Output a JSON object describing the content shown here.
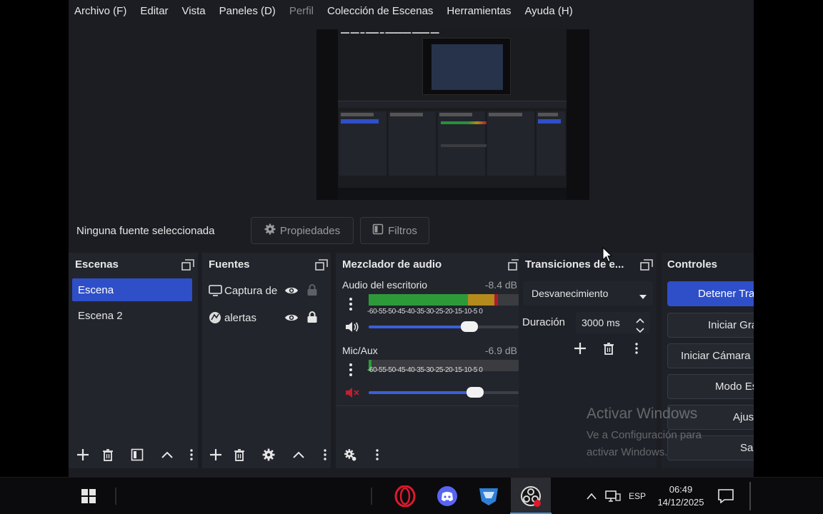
{
  "menubar": {
    "items": [
      {
        "label": "Archivo (F)",
        "dim": false
      },
      {
        "label": "Editar",
        "dim": false
      },
      {
        "label": "Vista",
        "dim": false
      },
      {
        "label": "Paneles (D)",
        "dim": false
      },
      {
        "label": "Perfil",
        "dim": true
      },
      {
        "label": "Colección de Escenas",
        "dim": false
      },
      {
        "label": "Herramientas",
        "dim": false
      },
      {
        "label": "Ayuda (H)",
        "dim": false
      }
    ]
  },
  "source_toolbar": {
    "no_source_label": "Ninguna fuente seleccionada",
    "properties_label": "Propiedades",
    "filters_label": "Filtros"
  },
  "scenes": {
    "title": "Escenas",
    "items": [
      "Escena",
      "Escena 2"
    ],
    "selected": "Escena"
  },
  "sources": {
    "title": "Fuentes",
    "items": [
      {
        "name": "Captura de",
        "icon": "monitor-icon",
        "visible": true,
        "locked": false
      },
      {
        "name": "alertas",
        "icon": "browser-icon",
        "visible": true,
        "locked": true
      }
    ]
  },
  "audio_mixer": {
    "title": "Mezclador de audio",
    "ticks": "-60-55-50-45-40-35-30-25-20-15-10-5 0",
    "channels": [
      {
        "name": "Audio del escritorio",
        "db": "-8.4 dB",
        "level": 0.86,
        "volume": 0.67,
        "muted": false
      },
      {
        "name": "Mic/Aux",
        "db": "-6.9 dB",
        "level": 0.02,
        "volume": 0.71,
        "muted": true
      }
    ]
  },
  "transitions": {
    "title": "Transiciones de e...",
    "selected": "Desvanecimiento",
    "duration_label": "Duración",
    "duration_value": "3000 ms"
  },
  "controls": {
    "title": "Controles",
    "buttons": [
      {
        "label": "Detener Transmisión",
        "primary": true
      },
      {
        "label": "Iniciar Grabación",
        "primary": false
      },
      {
        "label": "Iniciar Cámara Virtual",
        "primary": false
      },
      {
        "label": "Modo Estudio",
        "primary": false
      },
      {
        "label": "Ajustes",
        "primary": false
      },
      {
        "label": "Salir",
        "primary": false
      }
    ]
  },
  "watermark": {
    "line1": "Activar Windows",
    "line2": "Ve a Configuración para",
    "line3": "activar Windows."
  },
  "taskbar": {
    "lang": "ESP",
    "time": "06:49",
    "date": "14/12/2025",
    "apps": [
      "opera-icon",
      "discord-icon",
      "rocket-league-icon",
      "obs-icon"
    ]
  },
  "colors": {
    "accent": "#2f4fc9",
    "panel": "#22252c",
    "background": "#1b1d22"
  }
}
